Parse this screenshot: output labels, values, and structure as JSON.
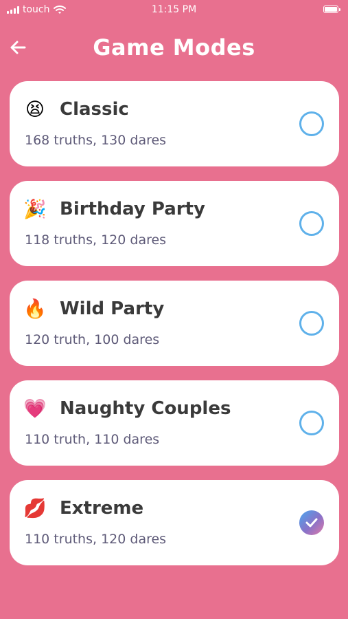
{
  "status_bar": {
    "carrier": "touch",
    "time": "11:15 PM"
  },
  "header": {
    "title": "Game Modes"
  },
  "modes": [
    {
      "name": "Classic",
      "count": "168 truths, 130 dares",
      "emoji": "😫",
      "selected": false
    },
    {
      "name": "Birthday Party",
      "count": "118 truths, 120 dares",
      "emoji": "🎉",
      "selected": false
    },
    {
      "name": "Wild Party",
      "count": "120 truth, 100 dares",
      "emoji": "🔥",
      "selected": false
    },
    {
      "name": "Naughty Couples",
      "count": "110 truth, 110 dares",
      "emoji": "💗",
      "selected": false
    },
    {
      "name": "Extreme",
      "count": "110 truths, 120 dares",
      "emoji": "💋",
      "selected": true
    }
  ],
  "colors": {
    "background": "#e8708f",
    "radio_border": "#5fb1ea",
    "title_text": "#ffffff"
  }
}
